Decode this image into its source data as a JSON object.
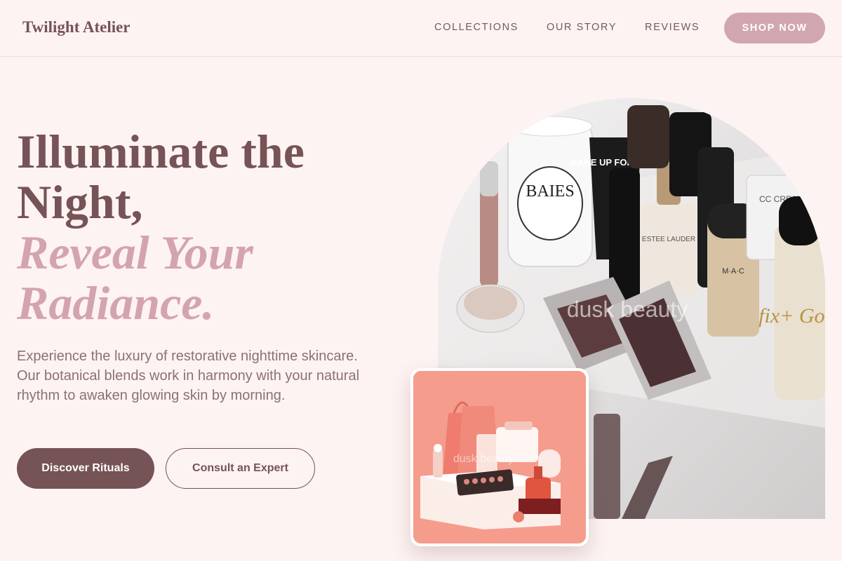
{
  "brand": {
    "name": "Twilight Atelier"
  },
  "nav": {
    "links": [
      "COLLECTIONS",
      "OUR STORY",
      "REVIEWS"
    ],
    "cta": "SHOP NOW"
  },
  "hero": {
    "headline_line1": "Illuminate the",
    "headline_line2": "Night,",
    "accent_line1": "Reveal Your",
    "accent_line2": "Radiance.",
    "description": "Experience the luxury of restorative nighttime skincare. Our botanical blends work in harmony with your natural rhythm to awaken glowing skin by morning.",
    "primary_button": "Discover Rituals",
    "secondary_button": "Consult an Expert"
  },
  "images": {
    "main": {
      "product_labels": [
        "BAIES",
        "MAKE UP FOR EVER",
        "ESTEE LAUDER",
        "M·A·C",
        "CC CREAM",
        "fix+ Gold"
      ],
      "watermark": "dusk beauty"
    },
    "secondary": {
      "watermark": "dusk beauty"
    }
  },
  "colors": {
    "background": "#fdf3f2",
    "brand": "#765356",
    "accent": "#d4a4ae",
    "shop_button": "#d2a6ae"
  }
}
